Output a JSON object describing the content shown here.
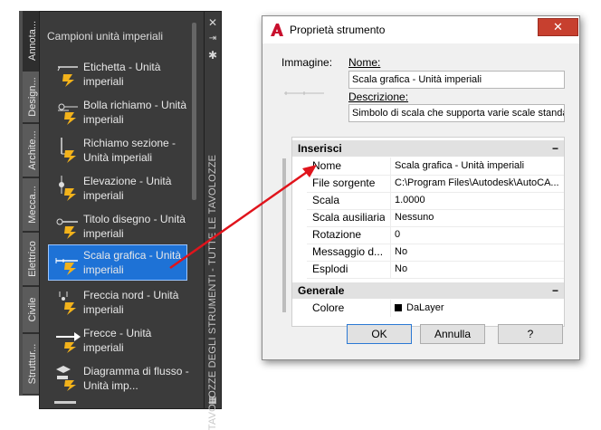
{
  "palette": {
    "title": "Campioni unità imperiali",
    "side_label": "TAVOLOZZE DEGLI STRUMENTI - TUTTE LE TAVOLOZZE",
    "tabs": [
      "Annota...",
      "Design...",
      "Archite...",
      "Mecca...",
      "Elettrico",
      "Civile",
      "Struttur..."
    ],
    "tools": [
      {
        "label": "Etichetta - Unità imperiali",
        "icon": "label-tool-icon"
      },
      {
        "label": "Bolla richiamo - Unità imperiali",
        "icon": "callout-bubble-icon"
      },
      {
        "label": "Richiamo sezione - Unità imperiali",
        "icon": "section-callout-icon"
      },
      {
        "label": "Elevazione - Unità imperiali",
        "icon": "elevation-icon"
      },
      {
        "label": "Titolo disegno - Unità imperiali",
        "icon": "drawing-title-icon"
      },
      {
        "label": "Scala grafica - Unità imperiali",
        "icon": "scale-bar-icon"
      },
      {
        "label": "Freccia nord - Unità imperiali",
        "icon": "north-arrow-icon"
      },
      {
        "label": "Frecce - Unità imperiali",
        "icon": "arrows-icon"
      },
      {
        "label": "Diagramma di flusso - Unità imp...",
        "icon": "flowchart-icon"
      }
    ],
    "selected_index": 5
  },
  "dialog": {
    "title": "Proprietà strumento",
    "image_label": "Immagine:",
    "name_label": "Nome:",
    "name_value": "Scala grafica - Unità imperiali",
    "desc_label": "Descrizione:",
    "desc_value": "Simbolo di scala che supporta varie scale standar",
    "sections": [
      {
        "title": "Inserisci",
        "rows": [
          {
            "key": "Nome",
            "value": "Scala grafica - Unità imperiali"
          },
          {
            "key": "File sorgente",
            "value": "C:\\Program Files\\Autodesk\\AutoCA..."
          },
          {
            "key": "Scala",
            "value": "1.0000"
          },
          {
            "key": "Scala ausiliaria",
            "value": "Nessuno"
          },
          {
            "key": "Rotazione",
            "value": "0"
          },
          {
            "key": "Messaggio d...",
            "value": "No"
          },
          {
            "key": "Esplodi",
            "value": "No"
          }
        ]
      },
      {
        "title": "Generale",
        "rows": [
          {
            "key": "Colore",
            "value": "DaLayer"
          }
        ]
      }
    ],
    "buttons": {
      "ok": "OK",
      "cancel": "Annulla",
      "help": "?"
    },
    "close": "✕"
  },
  "colors": {
    "accent": "#1e72d6",
    "arrow": "#e0141c",
    "app_logo": "#c8102e"
  }
}
